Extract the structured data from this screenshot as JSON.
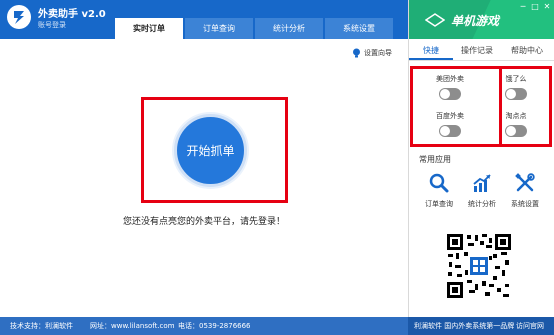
{
  "app": {
    "title": "外卖助手 v2.0",
    "account": "账号登录"
  },
  "tabs": [
    "实时订单",
    "订单查询",
    "统计分析",
    "系统设置"
  ],
  "main": {
    "guide": "设置向导",
    "start_button": "开始抓单",
    "hint": "您还没有点亮您的外卖平台，请先登录！"
  },
  "right": {
    "banner_text": "单机游戏",
    "window_controls": [
      "─",
      "□",
      "✕"
    ],
    "tabs": [
      "快捷",
      "操作记录",
      "帮助中心"
    ],
    "platforms": [
      {
        "label": "美团外卖",
        "enabled": false
      },
      {
        "label": "饿了么",
        "enabled": false
      },
      {
        "label": "百度外卖",
        "enabled": false
      },
      {
        "label": "淘点点",
        "enabled": false
      }
    ],
    "common_title": "常用应用",
    "apps": [
      {
        "label": "订单查询",
        "icon": "search-icon"
      },
      {
        "label": "统计分析",
        "icon": "chart-icon"
      },
      {
        "label": "系统设置",
        "icon": "tools-icon"
      }
    ]
  },
  "statusbar": {
    "support": "技术支持：利澜软件",
    "website": "网址：www.lilansoft.com",
    "phone": "电话：0539-2876666",
    "brand": "利澜软件 国内外卖系统第一品牌",
    "visit": "访问官网"
  },
  "colors": {
    "primary": "#1768c9",
    "banner": "#1fae76",
    "highlight": "#e60012",
    "button": "#2478db"
  }
}
